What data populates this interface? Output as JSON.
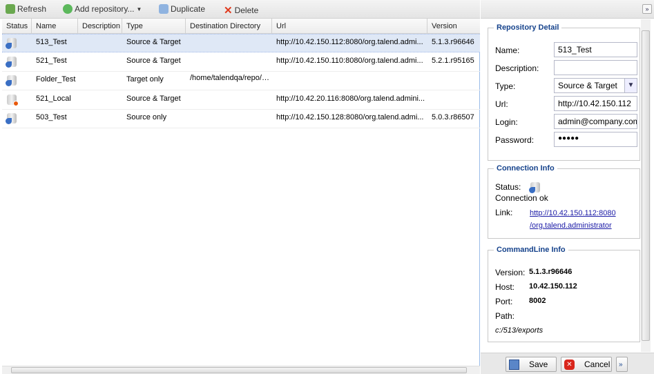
{
  "toolbar": {
    "refresh": "Refresh",
    "add_repository": "Add repository...",
    "duplicate": "Duplicate",
    "delete": "Delete"
  },
  "grid": {
    "columns": [
      "Status",
      "Name",
      "Description",
      "Type",
      "Destination Directory",
      "Url",
      "Version"
    ],
    "rows": [
      {
        "status": "ok",
        "name": "513_Test",
        "description": "",
        "type": "Source & Target",
        "destination": "",
        "url": "http://10.42.150.112:8080/org.talend.admi...",
        "version": "5.1.3.r96646"
      },
      {
        "status": "ok",
        "name": "521_Test",
        "description": "",
        "type": "Source & Target",
        "destination": "",
        "url": "http://10.42.150.110:8080/org.talend.admi...",
        "version": "5.2.1.r95165"
      },
      {
        "status": "ok",
        "name": "Folder_Test",
        "description": "",
        "type": "Target only",
        "destination": "/home/talendqa/repo/e...",
        "url": "",
        "version": ""
      },
      {
        "status": "error",
        "name": "521_Local",
        "description": "",
        "type": "Source & Target",
        "destination": "",
        "url": "http://10.42.20.116:8080/org.talend.admini...",
        "version": ""
      },
      {
        "status": "ok",
        "name": "503_Test",
        "description": "",
        "type": "Source only",
        "destination": "",
        "url": "http://10.42.150.128:8080/org.talend.admi...",
        "version": "5.0.3.r86507"
      }
    ]
  },
  "detail": {
    "title": "Repository Detail",
    "name_label": "Name:",
    "name": "513_Test",
    "description_label": "Description:",
    "description": "",
    "type_label": "Type:",
    "type": "Source & Target",
    "url_label": "Url:",
    "url": "http://10.42.150.112",
    "login_label": "Login:",
    "login": "admin@company.com",
    "password_label": "Password:",
    "password": "●●●●●"
  },
  "connection": {
    "title": "Connection Info",
    "status_label": "Status:",
    "status_text": "Connection ok",
    "link_label": "Link:",
    "link_line1": "http://10.42.150.112:8080",
    "link_line2": "/org.talend.administrator"
  },
  "commandline": {
    "title": "CommandLine Info",
    "version_label": "Version:",
    "version": "5.1.3.r96646",
    "host_label": "Host:",
    "host": "10.42.150.112",
    "port_label": "Port:",
    "port": "8002",
    "path_label": "Path:",
    "path": "c:/513/exports"
  },
  "footer": {
    "save": "Save",
    "cancel": "Cancel",
    "more": "»"
  },
  "collapse": "»"
}
